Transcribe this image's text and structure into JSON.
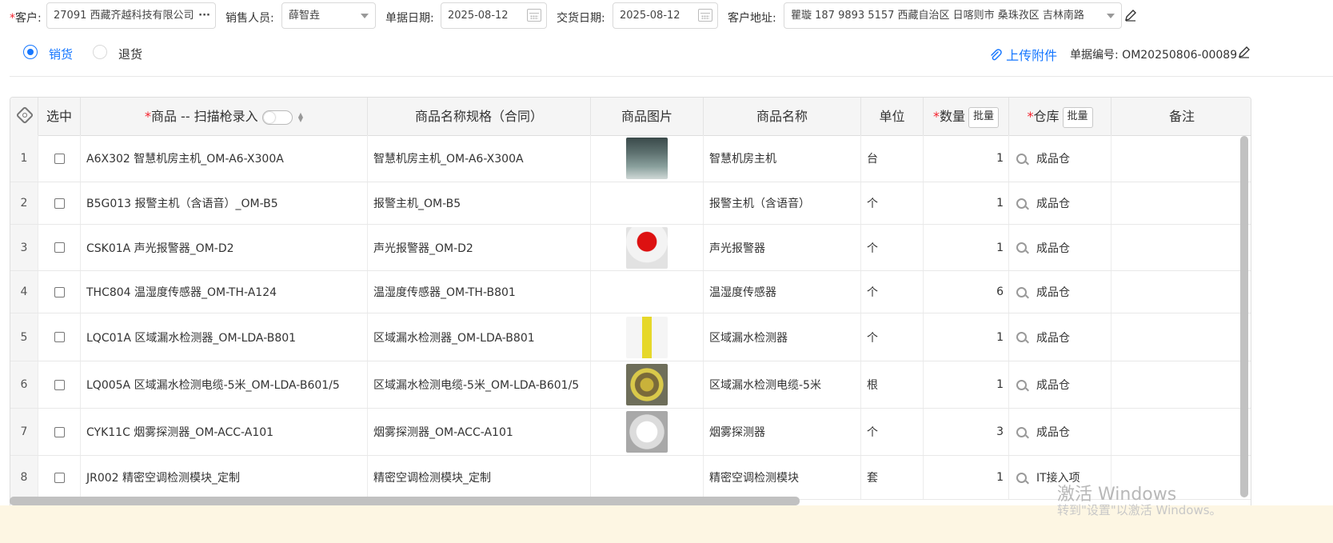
{
  "header": {
    "customer_label": "客户:",
    "customer_value": "27091 西藏齐越科技有限公司",
    "customer_more": "···",
    "sales_label": "销售人员:",
    "sales_value": "薛智垚",
    "doc_date_label": "单据日期:",
    "doc_date_value": "2025-08-12",
    "delivery_date_label": "交货日期:",
    "delivery_date_value": "2025-08-12",
    "address_label": "客户地址:",
    "address_value": "瞿璇 187 9893 5157 西藏自治区 日喀则市 桑珠孜区 吉林南路",
    "required_mark": "*"
  },
  "options": {
    "sale_label": "销货",
    "return_label": "退货",
    "selected": "销货",
    "upload_label": "上传附件",
    "doc_no_label": "单据编号:",
    "doc_no_value": "OM20250806-00089"
  },
  "table": {
    "columns": {
      "select": "选中",
      "product": "商品 -- 扫描枪录入",
      "contract_name": "商品名称规格（合同）",
      "image": "商品图片",
      "name": "商品名称",
      "unit": "单位",
      "qty": "数量",
      "warehouse": "仓库",
      "remark": "备注",
      "batch": "批量",
      "required_mark": "*"
    },
    "rows": [
      {
        "idx": "1",
        "product": "A6X302 智慧机房主机_OM-A6-X300A",
        "contract": "智慧机房主机_OM-A6-X300A",
        "image": "product-photo-server-host",
        "name": "智慧机房主机",
        "unit": "台",
        "qty": "1",
        "warehouse": "成品仓"
      },
      {
        "idx": "2",
        "product": "B5G013 报警主机（含语音）_OM-B5",
        "contract": "报警主机_OM-B5",
        "image": "",
        "name": "报警主机（含语音）",
        "unit": "个",
        "qty": "1",
        "warehouse": "成品仓"
      },
      {
        "idx": "3",
        "product": "CSK01A 声光报警器_OM-D2",
        "contract": "声光报警器_OM-D2",
        "image": "product-photo-alarm-siren",
        "name": "声光报警器",
        "unit": "个",
        "qty": "1",
        "warehouse": "成品仓"
      },
      {
        "idx": "4",
        "product": "THC804 温湿度传感器_OM-TH-A124",
        "contract": "温湿度传感器_OM-TH-B801",
        "image": "",
        "name": "温湿度传感器",
        "unit": "个",
        "qty": "6",
        "warehouse": "成品仓"
      },
      {
        "idx": "5",
        "product": "LQC01A 区域漏水检测器_OM-LDA-B801",
        "contract": "区域漏水检测器_OM-LDA-B801",
        "image": "product-photo-leak-detector",
        "name": "区域漏水检测器",
        "unit": "个",
        "qty": "1",
        "warehouse": "成品仓"
      },
      {
        "idx": "6",
        "product": "LQ005A 区域漏水检测电缆-5米_OM-LDA-B601/5",
        "contract": "区域漏水检测电缆-5米_OM-LDA-B601/5",
        "image": "product-photo-leak-cable",
        "name": "区域漏水检测电缆-5米",
        "unit": "根",
        "qty": "1",
        "warehouse": "成品仓"
      },
      {
        "idx": "7",
        "product": "CYK11C 烟雾探测器_OM-ACC-A101",
        "contract": "烟雾探测器_OM-ACC-A101",
        "image": "product-photo-smoke-detector",
        "name": "烟雾探测器",
        "unit": "个",
        "qty": "3",
        "warehouse": "成品仓"
      },
      {
        "idx": "8",
        "product": "JR002 精密空调检测模块_定制",
        "contract": "精密空调检测模块_定制",
        "image": "",
        "name": "精密空调检测模块",
        "unit": "套",
        "qty": "1",
        "warehouse": "IT接入项"
      }
    ]
  },
  "watermark": {
    "line1": "激活 Windows",
    "line2": "转到\"设置\"以激活 Windows。"
  },
  "colors": {
    "accent": "#1677ff",
    "required": "#f5222d",
    "header_bg": "#f5f5f5"
  },
  "icons": {
    "date": "calendar-icon",
    "edit": "edit-icon",
    "upload": "paperclip-icon",
    "settings": "settings-icon",
    "warehouse_search": "search-icon"
  }
}
